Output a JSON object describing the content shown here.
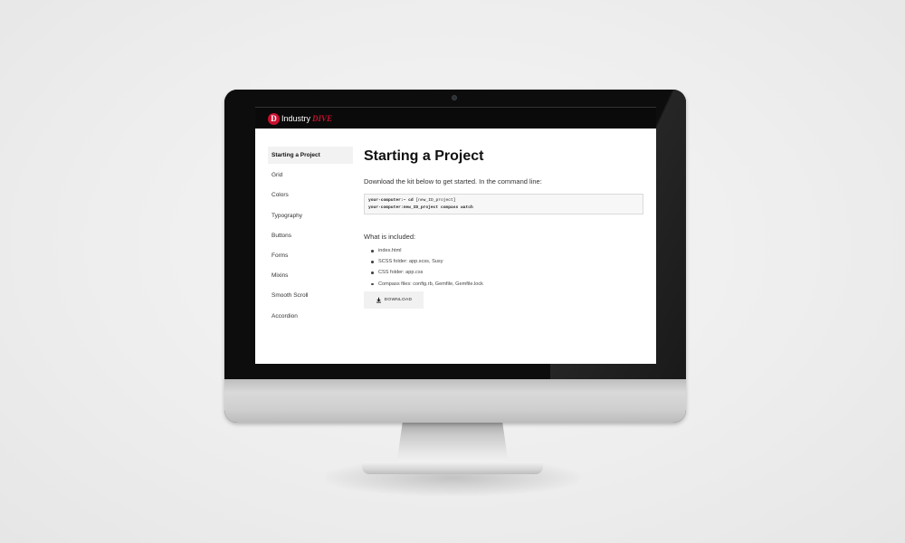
{
  "brand": {
    "logo_mark": "D",
    "logo_text_a": "Industry",
    "logo_text_b": "DIVE",
    "accent": "#c8102e"
  },
  "sidebar": {
    "items": [
      {
        "label": "Starting a Project",
        "active": true
      },
      {
        "label": "Grid"
      },
      {
        "label": "Colors"
      },
      {
        "label": "Typography"
      },
      {
        "label": "Buttons"
      },
      {
        "label": "Forms"
      },
      {
        "label": "Mixins"
      },
      {
        "label": "Smooth Scroll"
      },
      {
        "label": "Accordion"
      }
    ]
  },
  "main": {
    "title": "Starting a Project",
    "intro": "Download the kit below to get started. In the command line:",
    "code": [
      {
        "prompt": "your-computer:~",
        "command": "cd",
        "arg": "[new_ID_project]"
      },
      {
        "prompt": "your-computer:new_ID_project",
        "command": "compass watch",
        "arg": ""
      }
    ],
    "included_label": "What is included:",
    "included": [
      "index.html",
      "SCSS folder: app.scss, Susy",
      "CSS folder: app.css",
      "Compass files: config.rb, Gemfile, Gemfile.lock"
    ],
    "download_label": "DOWNLOAD",
    "download_icon": "download-icon"
  }
}
